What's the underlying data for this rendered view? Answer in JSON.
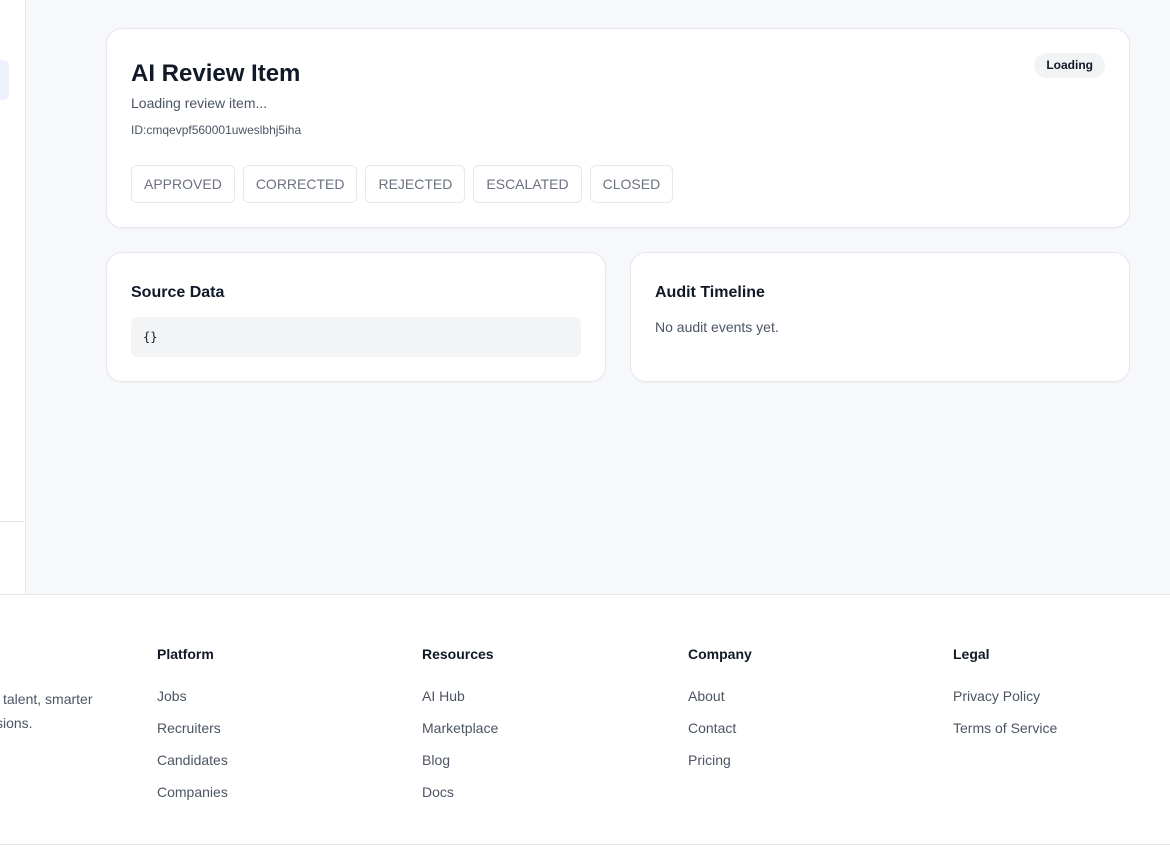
{
  "review": {
    "title": "AI Review Item",
    "status_badge": "Loading",
    "loading_text": "Loading review item...",
    "id_label": "ID:",
    "id_value": "cmqevpf560001uweslbhj5iha",
    "actions": [
      "APPROVED",
      "CORRECTED",
      "REJECTED",
      "ESCALATED",
      "CLOSED"
    ]
  },
  "source_data": {
    "heading": "Source Data",
    "content": "{}"
  },
  "audit": {
    "heading": "Audit Timeline",
    "empty_text": "No audit events yet."
  },
  "footer": {
    "tagline_line1": "l talent, smarter",
    "tagline_line2": "sions.",
    "columns": [
      {
        "heading": "Platform",
        "links": [
          "Jobs",
          "Recruiters",
          "Candidates",
          "Companies"
        ]
      },
      {
        "heading": "Resources",
        "links": [
          "AI Hub",
          "Marketplace",
          "Blog",
          "Docs"
        ]
      },
      {
        "heading": "Company",
        "links": [
          "About",
          "Contact",
          "Pricing"
        ]
      },
      {
        "heading": "Legal",
        "links": [
          "Privacy Policy",
          "Terms of Service"
        ]
      }
    ]
  }
}
